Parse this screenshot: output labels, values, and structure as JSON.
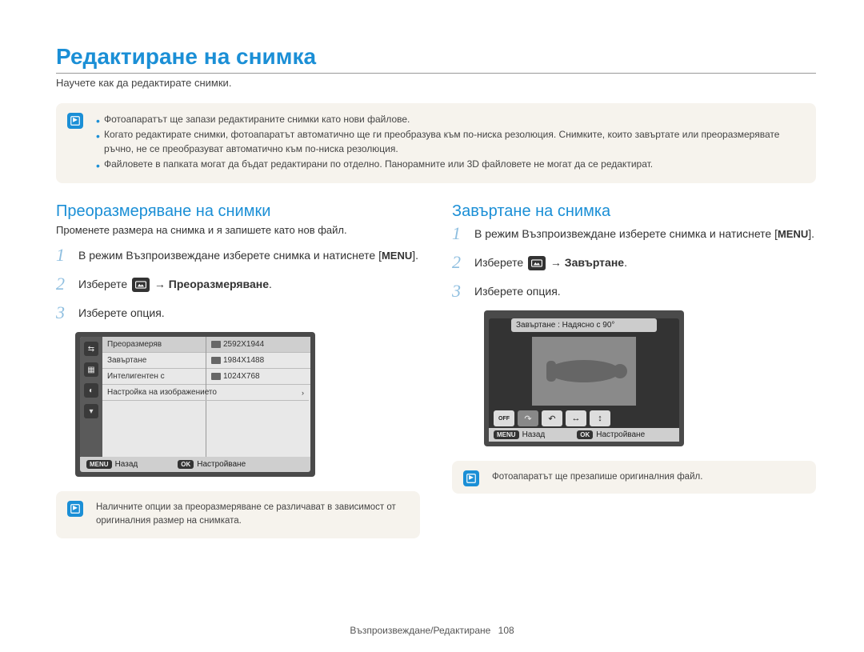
{
  "title": "Редактиране на снимка",
  "subtitle": "Научете как да редактирате снимки.",
  "top_notes": [
    "Фотоапаратът ще запази редактираните снимки като нови файлове.",
    "Когато редактирате снимки, фотоапаратът автоматично ще ги преобразува към по-ниска резолюция. Снимките, които завъртате или преоразмерявате ръчно, не се преобразуват автоматично към по-ниска резолюция.",
    "Файловете в папката могат да бъдат редактирани по отделно. Панорамните или 3D файловете не могат да се редактират."
  ],
  "left": {
    "section_title": "Преоразмеряване на снимки",
    "section_desc": "Променете размера на снимка и я запишете като нов файл.",
    "step1_pre": "В режим Възпроизвеждане изберете снимка и натиснете [",
    "step1_btn": "MENU",
    "step1_post": "].",
    "step2_pre": "Изберете ",
    "step2_arrow": " → ",
    "step2_bold": "Преоразмеряване",
    "step2_post": ".",
    "step3": "Изберете опция.",
    "menu_items": [
      "Преоразмеряв",
      "Завъртане",
      "Интелигентен с",
      "Настройка на изображението"
    ],
    "menu_sizes": [
      "2592X1944",
      "1984X1488",
      "1024X768"
    ],
    "back_label": "Назад",
    "back_btn": "MENU",
    "set_label": "Настройване",
    "set_btn": "OK",
    "note": "Наличните опции за преоразмеряване се различават в зависимост от оригиналния размер на снимката."
  },
  "right": {
    "section_title": "Завъртане на снимка",
    "step1_pre": "В режим Възпроизвеждане изберете снимка и натиснете [",
    "step1_btn": "MENU",
    "step1_post": "].",
    "step2_pre": "Изберете ",
    "step2_arrow": " → ",
    "step2_bold": "Завъртане",
    "step2_post": ".",
    "step3": "Изберете опция.",
    "rotate_header": "Завъртане : Надясно с 90°",
    "back_label": "Назад",
    "back_btn": "MENU",
    "set_label": "Настройване",
    "set_btn": "OK",
    "rotate_btns": [
      "OFF",
      "↷",
      "↶",
      "↔",
      "↕"
    ],
    "note": "Фотоапаратът ще презапише оригиналния файл."
  },
  "nums": {
    "n1": "1",
    "n2": "2",
    "n3": "3"
  },
  "footer": {
    "section": "Възпроизвеждане/Редактиране",
    "page": "108"
  }
}
